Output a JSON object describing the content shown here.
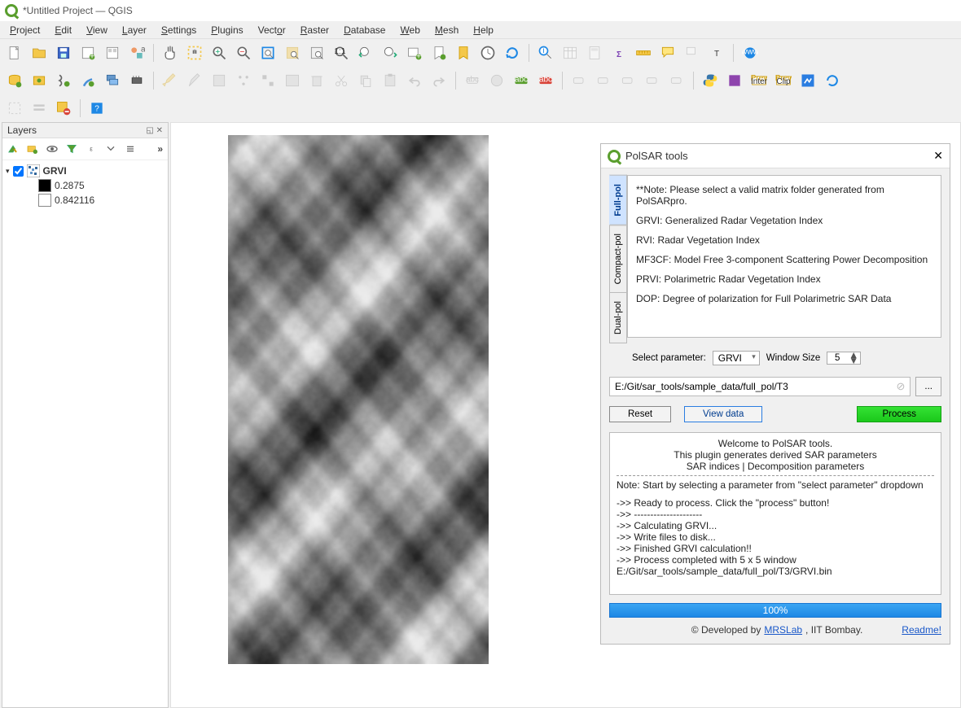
{
  "window": {
    "title": "*Untitled Project — QGIS"
  },
  "menus": [
    "Project",
    "Edit",
    "View",
    "Layer",
    "Settings",
    "Plugins",
    "Vector",
    "Raster",
    "Database",
    "Web",
    "Mesh",
    "Help"
  ],
  "layers_panel": {
    "title": "Layers",
    "tree": {
      "root_label": "GRVI",
      "band1_label": "0.2875",
      "band2_label": "0.842116"
    }
  },
  "polsar": {
    "title": "PolSAR tools",
    "tabs": [
      "Full-pol",
      "Compact-pol",
      "Dual-pol"
    ],
    "desc": {
      "note": "**Note: Please select a valid matrix folder generated from PolSARpro.",
      "grvi": "GRVI: Generalized Radar Vegetation Index",
      "rvi": "RVI: Radar Vegetation Index",
      "mf3cf": "MF3CF: Model Free 3-component Scattering Power Decomposition",
      "prvi": "PRVI: Polarimetric Radar Vegetation Index",
      "dop": "DOP: Degree of polarization for Full Polarimetric SAR Data"
    },
    "param_label": "Select parameter:",
    "param_value": "GRVI",
    "win_label": "Window Size",
    "win_value": "5",
    "path": "E:/Git/sar_tools/sample_data/full_pol/T3",
    "browse": "...",
    "reset": "Reset",
    "viewdata": "View data",
    "process": "Process",
    "log": {
      "l1": "Welcome to PolSAR tools.",
      "l2": "This plugin generates derived SAR parameters",
      "l3": "SAR indices | Decomposition parameters",
      "l4": "Note: Start by selecting a parameter from \"select parameter\" dropdown",
      "l5": "->> Ready to process. Click the \"process\" button!",
      "l6": "->> ---------------------",
      "l7": "->> Calculating GRVI...",
      "l8": "->> Write files to disk...",
      "l9": "->> Finished GRVI calculation!!",
      "l10": "->> Process completed with 5 x 5 window",
      "l11": "E:/Git/sar_tools/sample_data/full_pol/T3/GRVI.bin"
    },
    "progress": "100%",
    "credit_prefix": "© Developed by ",
    "credit_link": "MRSLab",
    "credit_suffix": ", IIT Bombay.",
    "readme": "Readme!"
  }
}
